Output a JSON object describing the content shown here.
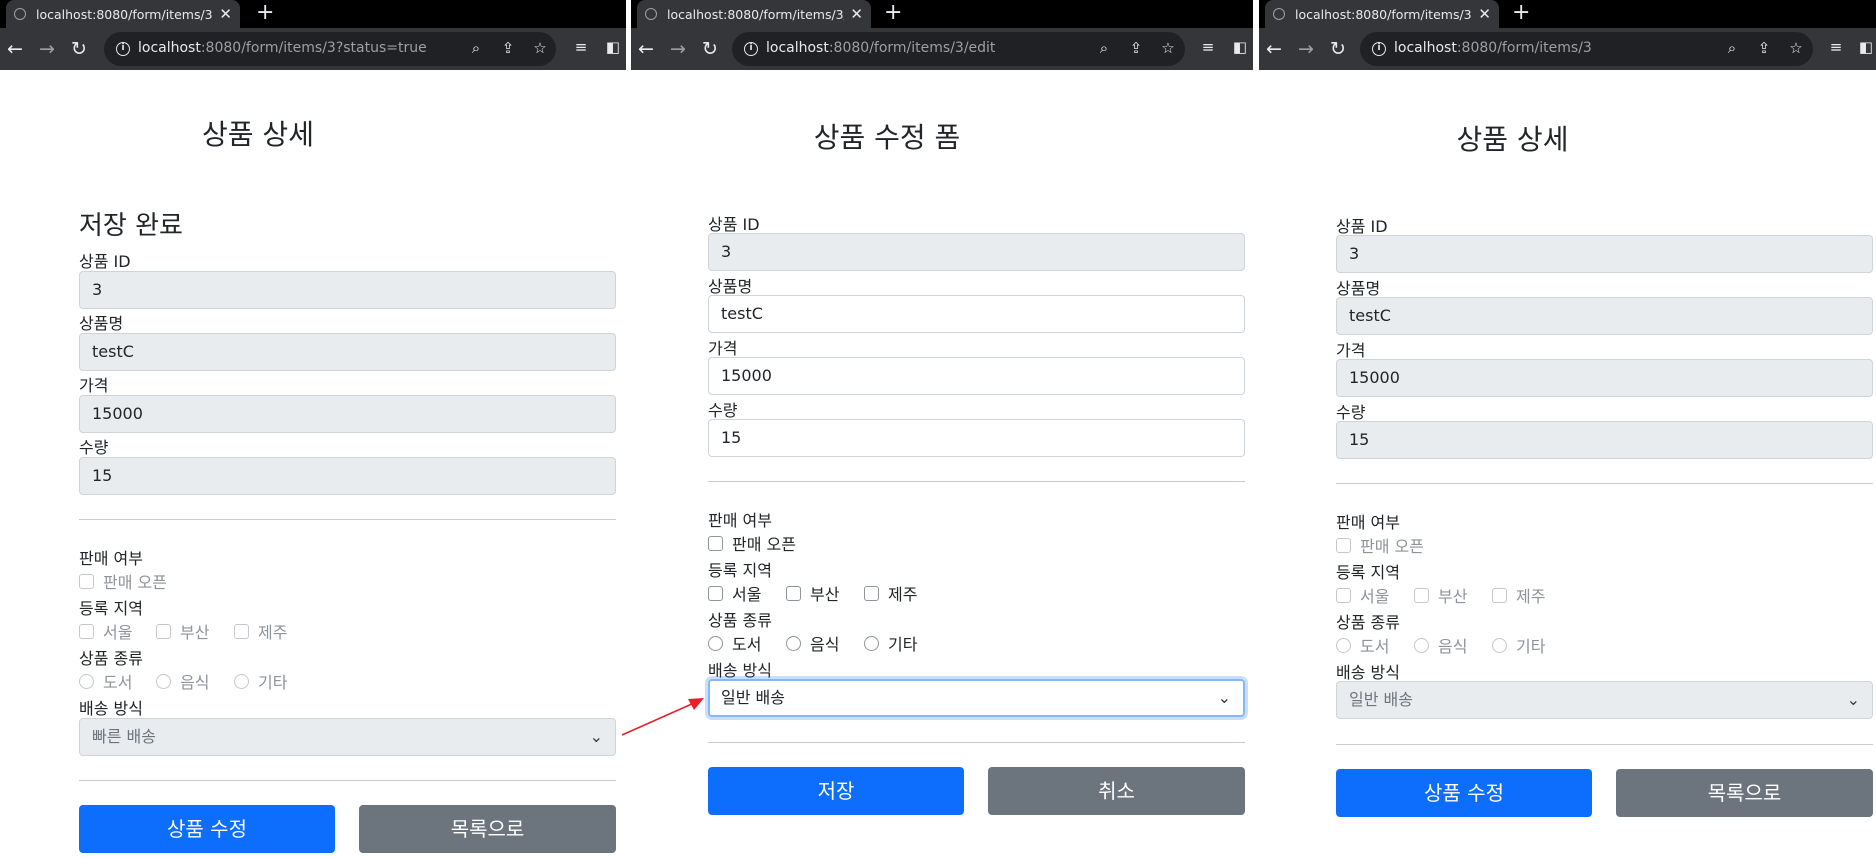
{
  "panels": [
    {
      "tab_title": "localhost:8080/form/items/3?status=true",
      "url_host": "localhost",
      "url_rest": ":8080/form/items/3?status=true",
      "heading": "상품 상세",
      "saved_heading": "저장 완료",
      "fields": [
        {
          "label": "상품 ID",
          "value": "3"
        },
        {
          "label": "상품명",
          "value": "testC"
        },
        {
          "label": "가격",
          "value": "15000"
        },
        {
          "label": "수량",
          "value": "15"
        }
      ],
      "open_label": "판매 여부",
      "open_option": "판매 오픈",
      "regions_label": "등록 지역",
      "regions": [
        "서울",
        "부산",
        "제주"
      ],
      "type_label": "상품 종류",
      "types": [
        "도서",
        "음식",
        "기타"
      ],
      "delivery_label": "배송 방식",
      "delivery_value": "빠른 배송",
      "primary_button": "상품 수정",
      "secondary_button": "목록으로"
    },
    {
      "tab_title": "localhost:8080/form/items/3/edit",
      "url_host": "localhost",
      "url_rest": ":8080/form/items/3/edit",
      "heading": "상품 수정 폼",
      "fields": [
        {
          "label": "상품 ID",
          "value": "3"
        },
        {
          "label": "상품명",
          "value": "testC"
        },
        {
          "label": "가격",
          "value": "15000"
        },
        {
          "label": "수량",
          "value": "15"
        }
      ],
      "open_label": "판매 여부",
      "open_option": "판매 오픈",
      "regions_label": "등록 지역",
      "regions": [
        "서울",
        "부산",
        "제주"
      ],
      "type_label": "상품 종류",
      "types": [
        "도서",
        "음식",
        "기타"
      ],
      "delivery_label": "배송 방식",
      "delivery_value": "일반 배송",
      "primary_button": "저장",
      "secondary_button": "취소"
    },
    {
      "tab_title": "localhost:8080/form/items/3",
      "url_host": "localhost",
      "url_rest": ":8080/form/items/3",
      "heading": "상품 상세",
      "fields": [
        {
          "label": "상품 ID",
          "value": "3"
        },
        {
          "label": "상품명",
          "value": "testC"
        },
        {
          "label": "가격",
          "value": "15000"
        },
        {
          "label": "수량",
          "value": "15"
        }
      ],
      "open_label": "판매 여부",
      "open_option": "판매 오픈",
      "regions_label": "등록 지역",
      "regions": [
        "서울",
        "부산",
        "제주"
      ],
      "type_label": "상품 종류",
      "types": [
        "도서",
        "음식",
        "기타"
      ],
      "delivery_label": "배송 방식",
      "delivery_value": "일반 배송",
      "primary_button": "상품 수정",
      "secondary_button": "목록으로"
    }
  ],
  "colors": {
    "primary": "#0d6efd",
    "secondary": "#6c757d",
    "readonly_bg": "#e9ecef",
    "annotation_arrow": "#e8202a",
    "browser_chrome": "#35363a"
  },
  "icons": {
    "back": "arrow-left-icon",
    "forward": "arrow-right-icon",
    "reload": "reload-icon",
    "site_info": "info-icon",
    "search": "search-icon",
    "share": "share-icon",
    "bookmark": "star-icon",
    "tab_search": "tab-search-icon",
    "side_panel": "side-panel-icon",
    "dropdown": "chevron-down-icon"
  }
}
